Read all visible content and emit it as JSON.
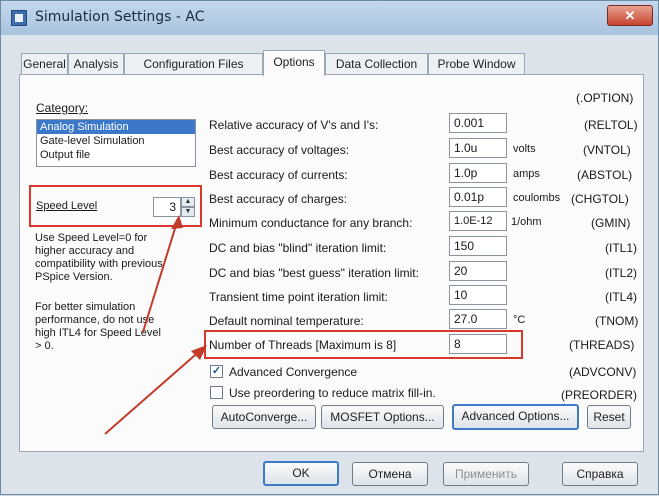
{
  "window": {
    "title": "Simulation Settings - AC",
    "close_label": "✕"
  },
  "tabs": [
    {
      "label": "General"
    },
    {
      "label": "Analysis"
    },
    {
      "label": "Configuration Files"
    },
    {
      "label": "Options"
    },
    {
      "label": "Data Collection"
    },
    {
      "label": "Probe Window"
    }
  ],
  "category": {
    "label": "Category:",
    "items": [
      "Analog Simulation",
      "Gate-level Simulation",
      "Output file"
    ],
    "selected": "Analog Simulation"
  },
  "speed_level": {
    "label": "Speed Level",
    "value": "3"
  },
  "notes": {
    "speed_note": [
      "Use Speed Level=0 for",
      "higher accuracy and",
      "compatibility with previous",
      "PSpice Version."
    ],
    "itl4_note": [
      "For better simulation",
      "performance, do not use",
      "high ITL4 for Speed Level",
      "> 0."
    ]
  },
  "option_header": "(.OPTION)",
  "options": [
    {
      "label": "Relative accuracy of V's and I's:",
      "value": "0.001",
      "unit": "",
      "code": "(RELTOL)"
    },
    {
      "label": "Best accuracy of voltages:",
      "value": "1.0u",
      "unit": "volts",
      "code": "(VNTOL)"
    },
    {
      "label": "Best accuracy of currents:",
      "value": "1.0p",
      "unit": "amps",
      "code": "(ABSTOL)"
    },
    {
      "label": "Best accuracy of charges:",
      "value": "0.01p",
      "unit": "coulombs",
      "code": "(CHGTOL)"
    },
    {
      "label": "Minimum conductance for any branch:",
      "value": "1.0E-12",
      "unit": "1/ohm",
      "code": "(GMIN)"
    },
    {
      "label": "DC and bias \"blind\" iteration limit:",
      "value": "150",
      "unit": "",
      "code": "(ITL1)"
    },
    {
      "label": "DC and bias \"best guess\" iteration limit:",
      "value": "20",
      "unit": "",
      "code": "(ITL2)"
    },
    {
      "label": "Transient time point iteration limit:",
      "value": "10",
      "unit": "",
      "code": "(ITL4)"
    },
    {
      "label": "Default nominal temperature:",
      "value": "27.0",
      "unit": "°C",
      "code": "(TNOM)"
    },
    {
      "label": "Number of Threads [Maximum is 8]",
      "value": "8",
      "unit": "",
      "code": "(THREADS)"
    }
  ],
  "checks": [
    {
      "label": "Advanced Convergence",
      "checked": "✓",
      "code": "(ADVCONV)"
    },
    {
      "label": "Use preordering to reduce matrix fill-in.",
      "checked": "",
      "code": "(PREORDER)"
    }
  ],
  "option_buttons": [
    "AutoConverge...",
    "MOSFET Options...",
    "Advanced Options...",
    "Reset"
  ],
  "dialog_buttons": [
    "OK",
    "Отмена",
    "Применить",
    "Справка"
  ],
  "colors": {
    "highlight_box": "#d9392a",
    "arrow": "#c23a2a",
    "selection": "#3b78c9"
  }
}
